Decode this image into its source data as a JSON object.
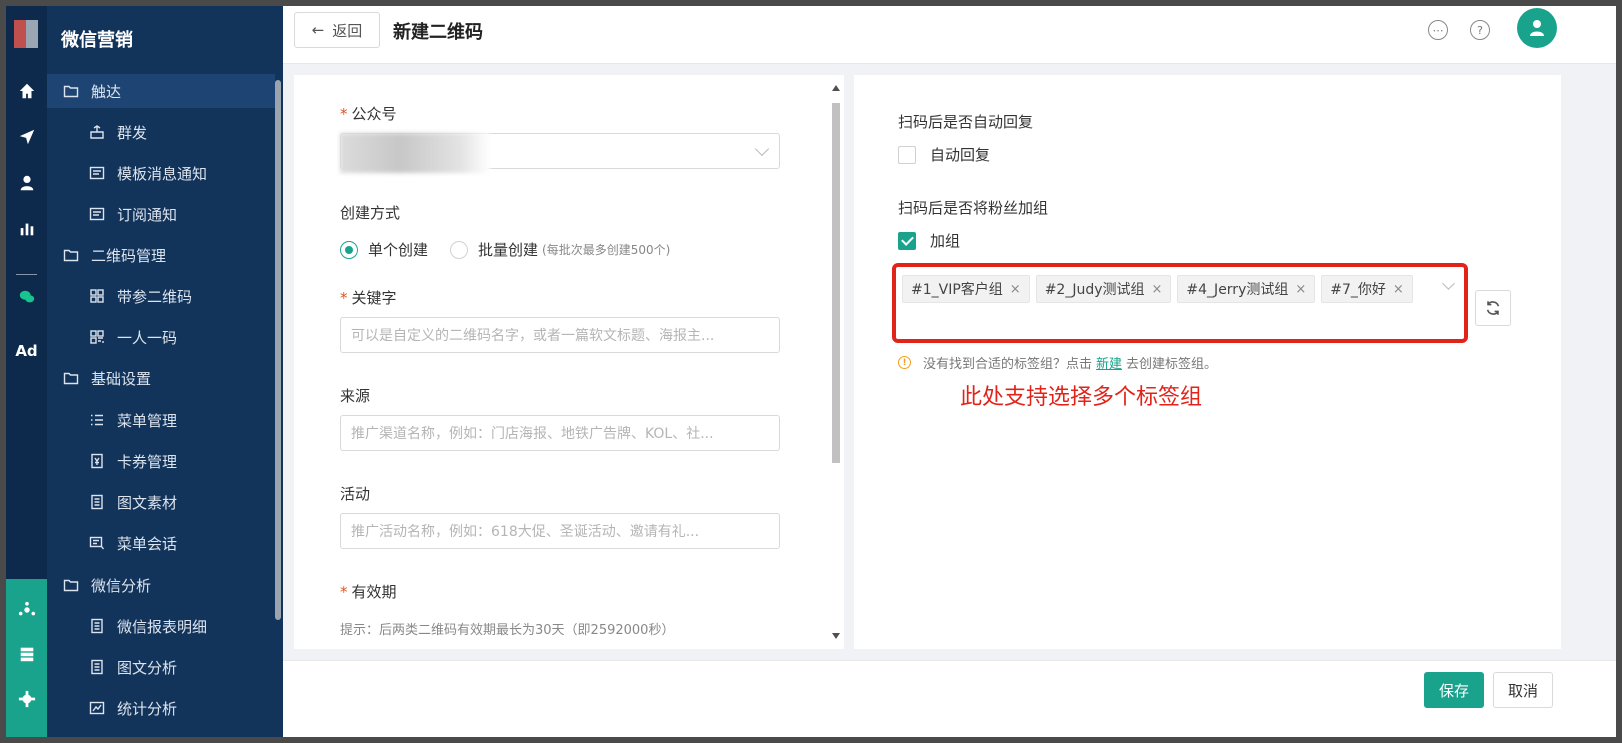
{
  "app": {
    "title": "微信营销"
  },
  "rail": {
    "ad_label": "Ad"
  },
  "sidebar": {
    "items": [
      {
        "label": "触达"
      },
      {
        "label": "群发"
      },
      {
        "label": "模板消息通知"
      },
      {
        "label": "订阅通知"
      },
      {
        "label": "二维码管理"
      },
      {
        "label": "带参二维码"
      },
      {
        "label": "一人一码"
      },
      {
        "label": "基础设置"
      },
      {
        "label": "菜单管理"
      },
      {
        "label": "卡券管理"
      },
      {
        "label": "图文素材"
      },
      {
        "label": "菜单会话"
      },
      {
        "label": "微信分析"
      },
      {
        "label": "微信报表明细"
      },
      {
        "label": "图文分析"
      },
      {
        "label": "统计分析"
      }
    ]
  },
  "header": {
    "back_label": "返回",
    "title": "新建二维码"
  },
  "form": {
    "account_label": "公众号",
    "method_label": "创建方式",
    "method_single": "单个创建",
    "method_batch": "批量创建",
    "method_batch_hint": "(每批次最多创建500个)",
    "keyword_label": "关键字",
    "keyword_placeholder": "可以是自定义的二维码名字，或者一篇软文标题、海报主...",
    "source_label": "来源",
    "source_placeholder": "推广渠道名称，例如：门店海报、地铁广告牌、KOL、社...",
    "activity_label": "活动",
    "activity_placeholder": "推广活动名称，例如：618大促、圣诞活动、邀请有礼...",
    "validity_label": "有效期",
    "validity_tip": "提示：后两类二维码有效期最长为30天（即2592000秒）"
  },
  "right": {
    "auto_reply_q": "扫码后是否自动回复",
    "auto_reply_opt": "自动回复",
    "group_q": "扫码后是否将粉丝加组",
    "group_opt": "加组",
    "tags": [
      {
        "label": "#1_VIP客户组"
      },
      {
        "label": "#2_Judy测试组"
      },
      {
        "label": "#4_Jerry测试组"
      },
      {
        "label": "#7_你好"
      }
    ],
    "tag_remove": "×",
    "warn_prefix": "没有找到合适的标签组？点击",
    "warn_link": "新建",
    "warn_suffix": "去创建标签组。",
    "annotation": "此处支持选择多个标签组"
  },
  "footer": {
    "save_label": "保存",
    "cancel_label": "取消"
  },
  "colors": {
    "accent": "#19a38d",
    "sidebar_bg": "#12335a",
    "rail_bg": "#0d2a4c",
    "annotation": "#e2231a"
  }
}
